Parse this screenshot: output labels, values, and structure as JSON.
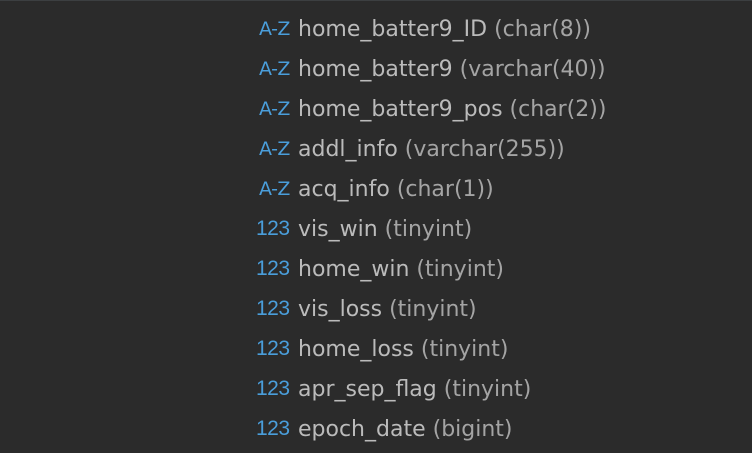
{
  "columns": [
    {
      "icon": "A-Z",
      "icon_name": "text-type-icon",
      "name": "home_batter9_ID",
      "type": "(char(8))"
    },
    {
      "icon": "A-Z",
      "icon_name": "text-type-icon",
      "name": "home_batter9",
      "type": "(varchar(40))"
    },
    {
      "icon": "A-Z",
      "icon_name": "text-type-icon",
      "name": "home_batter9_pos",
      "type": "(char(2))"
    },
    {
      "icon": "A-Z",
      "icon_name": "text-type-icon",
      "name": "addl_info",
      "type": "(varchar(255))"
    },
    {
      "icon": "A-Z",
      "icon_name": "text-type-icon",
      "name": "acq_info",
      "type": "(char(1))"
    },
    {
      "icon": "123",
      "icon_name": "numeric-type-icon",
      "name": "vis_win",
      "type": "(tinyint)"
    },
    {
      "icon": "123",
      "icon_name": "numeric-type-icon",
      "name": "home_win",
      "type": "(tinyint)"
    },
    {
      "icon": "123",
      "icon_name": "numeric-type-icon",
      "name": "vis_loss",
      "type": "(tinyint)"
    },
    {
      "icon": "123",
      "icon_name": "numeric-type-icon",
      "name": "home_loss",
      "type": "(tinyint)"
    },
    {
      "icon": "123",
      "icon_name": "numeric-type-icon",
      "name": "apr_sep_flag",
      "type": "(tinyint)"
    },
    {
      "icon": "123",
      "icon_name": "numeric-type-icon",
      "name": "epoch_date",
      "type": "(bigint)"
    }
  ],
  "colors": {
    "background": "#2b2b2b",
    "icon": "#4a9edb",
    "name_text": "#bbbbbb",
    "type_text": "#a4a4a4"
  }
}
